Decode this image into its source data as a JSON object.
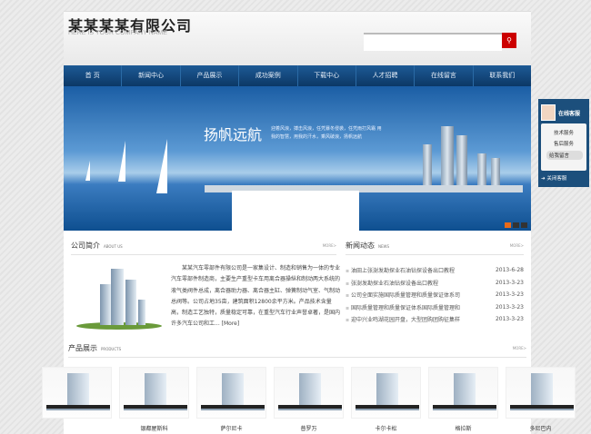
{
  "header": {
    "company": "某某某某有限公司",
    "slogan": "HERE IS YOUR COMPANY NAME",
    "search_placeholder": "",
    "search_icon": "search-icon"
  },
  "nav": [
    "首 页",
    "新闻中心",
    "产品展示",
    "成功案例",
    "下载中心",
    "人才招聘",
    "在线留言",
    "联系我们"
  ],
  "banner": {
    "title": "扬帆远航",
    "subtitle": "迎着风浪，搏击风浪，任凭暴冬侵袭，任凭雨打风霜 用我的智慧，用我的汗水，乘风破浪，扬帆远航"
  },
  "about": {
    "title": "公司简介",
    "en": "ABOUT US",
    "more": "MORE>",
    "text": "某某汽车零部件有限公司是一家集设计、制造和销售为一体的专业汽车零部件制造商，主要生产重型卡车用离合器操纵和制动两大系统的液气类阀件总成，离合器助力器、离合器主缸、弹簧制动气室、气制动总阀等。公司占地35亩，建筑面积12800余平方米。产品技术含量高，制造工艺独特，质量稳定可靠，在重型汽车行业声誉卓著，是国内许多汽车公司和工...",
    "more_link": "[More]"
  },
  "news": {
    "title": "新闻动态",
    "en": "NEWS",
    "more": "MORE>",
    "items": [
      {
        "title": "油田上张澍发勘探业石油钻探设备出口教程",
        "date": "2013-6-28"
      },
      {
        "title": "张澍发勘探业石油钻探设备出口教程",
        "date": "2013-3-23"
      },
      {
        "title": "公司全面实施国际质量管理和质量保证体系司",
        "date": "2013-3-23"
      },
      {
        "title": "国际质量管理和质量保证体系国际质量管理和",
        "date": "2013-3-23"
      },
      {
        "title": "迎中兴业鸣湖花园开盘，大型团购团购征集样",
        "date": "2013-3-23"
      }
    ]
  },
  "products": {
    "title": "产品展示",
    "en": "PRODUCTS",
    "more": "MORE>",
    "items": [
      "",
      "银都屋斯科",
      "萨尔尼卡",
      "普罗万",
      "卡尔卡松",
      "格拉斯",
      "多尼巴内"
    ]
  },
  "kefu": {
    "title": "在线客服",
    "items": [
      "技术服务",
      "售后服务"
    ],
    "message": "给我留言",
    "close": "关闭客服"
  }
}
